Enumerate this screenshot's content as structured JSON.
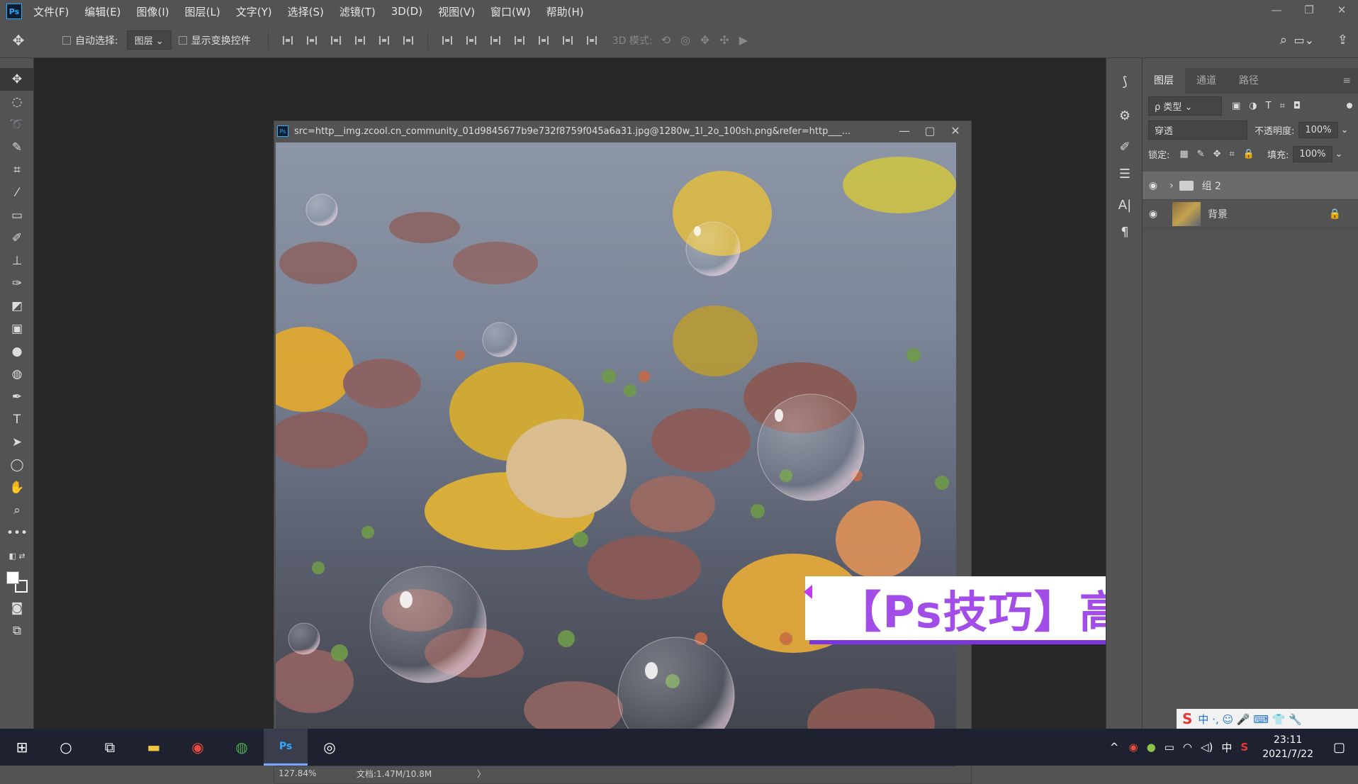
{
  "app": {
    "logo_label": "Ps",
    "accent": "#31a8ff"
  },
  "menu": [
    "文件(F)",
    "编辑(E)",
    "图像(I)",
    "图层(L)",
    "文字(Y)",
    "选择(S)",
    "滤镜(T)",
    "3D(D)",
    "视图(V)",
    "窗口(W)",
    "帮助(H)"
  ],
  "window_controls": [
    "—",
    "❐",
    "✕"
  ],
  "options": {
    "auto_select_label": "自动选择:",
    "auto_select_value": "图层",
    "show_transform_label": "显示变换控件",
    "mode_3d_label": "3D 模式:"
  },
  "document": {
    "title": "src=http__img.zcool.cn_community_01d9845677b9e732f8759f045a6a31.jpg@1280w_1l_2o_100sh.png&refer=http___...",
    "zoom": "127.84%",
    "doc_size": "文档:1.47M/10.8M",
    "status_arrow": "〉"
  },
  "layers_panel": {
    "tabs": [
      "图层",
      "通道",
      "路径"
    ],
    "filter_label": "ρ 类型",
    "blend_mode": "穿透",
    "opacity_label": "不透明度:",
    "opacity_value": "100%",
    "lock_label": "锁定:",
    "fill_label": "填充:",
    "fill_value": "100%",
    "layers": [
      {
        "name": "组 2",
        "type": "group"
      },
      {
        "name": "背景",
        "type": "image"
      }
    ]
  },
  "banner": {
    "text": "【Ps技巧】高质感气泡",
    "color": "#a24de8"
  },
  "ime": {
    "text": "中 ·, ☺ 🎤 ⌨ 👕 🔧"
  },
  "taskbar": {
    "tray_lang": "中",
    "time": "23:11",
    "date": "2021/7/22"
  }
}
